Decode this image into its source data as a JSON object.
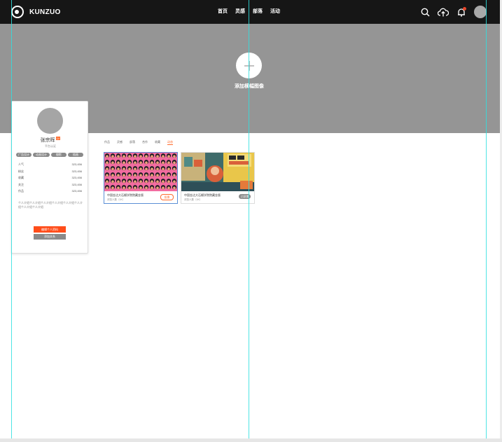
{
  "header": {
    "logo_text": "KUNZUO",
    "nav": [
      "首页",
      "灵感",
      "部落",
      "活动"
    ],
    "icons": [
      "search-icon",
      "upload-cloud-icon",
      "bell-icon",
      "avatar"
    ],
    "notification_color": "#e8452a"
  },
  "cover": {
    "add_label": "添加横幅图像",
    "background": "#959595"
  },
  "profile": {
    "name": "张宗晖",
    "level_badge": "LV",
    "subtitle": "平台认证",
    "tags": [
      "广告设计",
      "动画设计",
      "摄影",
      "插画"
    ],
    "stats": [
      {
        "label": "人气",
        "value": "323,456"
      },
      {
        "label": "粉丝",
        "value": "323,456"
      },
      {
        "label": "收藏",
        "value": "323,456"
      },
      {
        "label": "关注",
        "value": "323,456"
      },
      {
        "label": "作品",
        "value": "323,456"
      }
    ],
    "description": "个人介绍个人介绍个人介绍个人介绍个人介绍个人介绍个人介绍个人介绍",
    "edit_button": "编辑个人资料",
    "follow_button": "添加关系"
  },
  "tabs": {
    "items": [
      "作品",
      "灵感",
      "部落",
      "合作",
      "收藏",
      "动态"
    ],
    "active_index": 5
  },
  "works": [
    {
      "title": "中国金达大石榴学院院藏金版",
      "meta": "浏览人数（1K）",
      "badge": "投票"
    },
    {
      "title": "中国金达大石榴学院院藏金版",
      "meta": "浏览人数（1K）",
      "badge": "已获票"
    }
  ],
  "colors": {
    "accent": "#ff4d1a",
    "guide_lines": "#2fe0e0",
    "topbar": "#161616"
  }
}
